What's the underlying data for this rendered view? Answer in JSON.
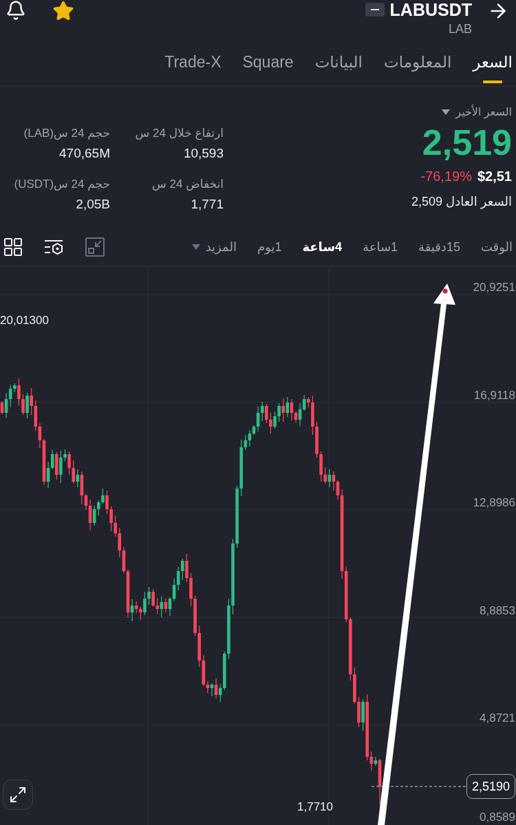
{
  "header": {
    "favorite": true,
    "symbol": "LABUSDT",
    "base": "LAB"
  },
  "tabs": [
    {
      "label": "السعر",
      "selected": true
    },
    {
      "label": "المعلومات",
      "selected": false
    },
    {
      "label": "البيانات",
      "selected": false
    },
    {
      "label": "Square",
      "selected": false
    },
    {
      "label": "Trade-X",
      "selected": false
    }
  ],
  "price": {
    "label": "السعر الأخير",
    "last": "2,519",
    "last_up": true,
    "usd": "$2,51",
    "change": "-76,19%",
    "change_up": false,
    "fair": "السعر العادل 2,509"
  },
  "stats": [
    {
      "label": "ارتفاع خلال 24 س",
      "value": "10,593"
    },
    {
      "label": "حجم 24 س(LAB)",
      "value": "470,65M"
    },
    {
      "label": "انخفاض 24 س",
      "value": "1,771"
    },
    {
      "label": "حجم 24 س(USDT)",
      "value": "2,05B"
    }
  ],
  "timeframes": [
    {
      "label": "الوقت",
      "kind": "option",
      "selected": false
    },
    {
      "label": "15دقيقة",
      "kind": "option",
      "selected": false
    },
    {
      "label": "1ساعة",
      "kind": "option",
      "selected": false
    },
    {
      "label": "4ساعة",
      "kind": "option",
      "selected": true
    },
    {
      "label": "1يوم",
      "kind": "option",
      "selected": false
    },
    {
      "label": "المزيد",
      "kind": "menu",
      "selected": false
    }
  ],
  "chart_tools": [
    {
      "kind": "collapse",
      "disabled": true
    },
    {
      "kind": "indicators",
      "disabled": false
    },
    {
      "kind": "layout",
      "disabled": false
    }
  ],
  "chart": {
    "price_axis": [
      "20,9251",
      "16,9118",
      "12,8986",
      "8,8853",
      "4,8721",
      "0,8589"
    ],
    "high_marker": "20,01300",
    "low_marker": "1,7710",
    "current_price": "2,5190"
  }
}
